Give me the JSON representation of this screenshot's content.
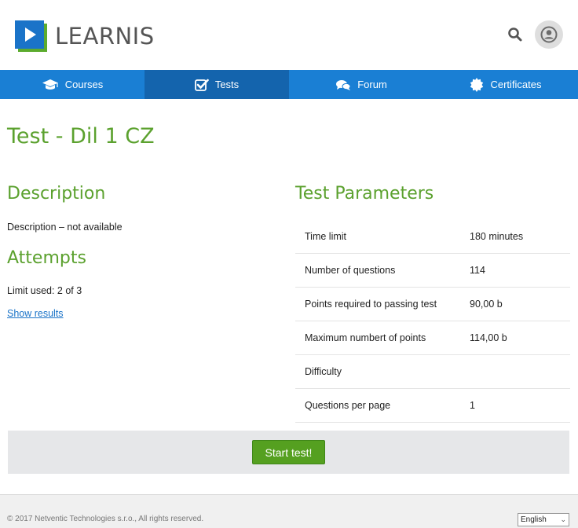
{
  "header": {
    "logo_text": "LEARNIS",
    "brand_colors": {
      "primary": "#1a73c8",
      "secondary": "#5cab2e"
    },
    "icons": [
      "search-icon",
      "user-icon"
    ]
  },
  "nav": {
    "items": [
      {
        "label": "Courses",
        "icon": "graduation-cap-icon",
        "active": false
      },
      {
        "label": "Tests",
        "icon": "checkbox-icon",
        "active": true
      },
      {
        "label": "Forum",
        "icon": "chat-bubbles-icon",
        "active": false
      },
      {
        "label": "Certificates",
        "icon": "certificate-icon",
        "active": false
      }
    ],
    "color": "#1a7fd4",
    "active_color": "#1464ad"
  },
  "main": {
    "title": "Test - Dil 1 CZ",
    "description_heading": "Description",
    "description_text": "Description – not available",
    "attempts_heading": "Attempts",
    "attempts_text": "Limit used: 2 of 3",
    "show_results": "Show results",
    "params_heading": "Test Parameters",
    "params": [
      {
        "label": "Time limit",
        "value": "180 minutes"
      },
      {
        "label": "Number of questions",
        "value": "114"
      },
      {
        "label": "Points required to passing test",
        "value": "90,00 b"
      },
      {
        "label": "Maximum numbert of points",
        "value": "114,00 b"
      },
      {
        "label": "Difficulty",
        "value": ""
      },
      {
        "label": "Questions per page",
        "value": "1"
      }
    ],
    "start_button": "Start test!",
    "accent_color": "#5ba12e"
  },
  "footer": {
    "copyright": "© 2017 Netventic Technologies s.r.o., All rights reserved.",
    "language": "English"
  }
}
